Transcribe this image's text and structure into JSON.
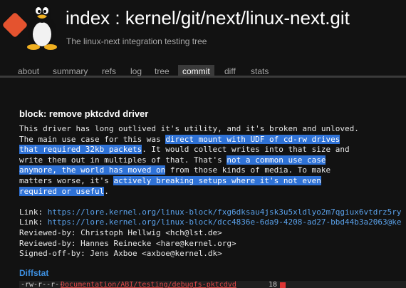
{
  "header": {
    "title": "index : kernel/git/next/linux-next.git",
    "subtitle": "The linux-next integration testing tree"
  },
  "tabs": [
    {
      "label": "about"
    },
    {
      "label": "summary"
    },
    {
      "label": "refs"
    },
    {
      "label": "log"
    },
    {
      "label": "tree"
    },
    {
      "label": "commit",
      "active": true
    },
    {
      "label": "diff"
    },
    {
      "label": "stats"
    }
  ],
  "commit": {
    "title": "block: remove pktcdvd driver",
    "message_segments": [
      {
        "text": "This driver has long outlived it's utility, and it's broken and unloved.\nThe main use case for this was "
      },
      {
        "text": "direct mount with UDF of cd-rw drives\nthat required 32kb packets",
        "selected": true
      },
      {
        "text": ". It would collect writes into that size and\nwrite them out in multiples of that. That's "
      },
      {
        "text": "not a common use case\nanymore, the world has moved on",
        "selected": true
      },
      {
        "text": " from those kinds of media. To make\nmatters worse, it's "
      },
      {
        "text": "actively breaking setups where it's not even\nrequired or useful",
        "selected": true
      },
      {
        "text": ".\n\nLink: "
      },
      {
        "text": "https://lore.kernel.org/linux-block/fxg6dksau4jsk3u5xldlyo2m7qgiux6vtdrz5ry",
        "link": true
      },
      {
        "text": "\nLink: "
      },
      {
        "text": "https://lore.kernel.org/linux-block/dcc4836e-6da9-4208-ad27-bbd44b3a2063@ke",
        "link": true
      },
      {
        "text": "\nReviewed-by: Christoph Hellwig <hch@lst.de>\nReviewed-by: Hannes Reinecke <hare@kernel.org>\nSigned-off-by: Jens Axboe <axboe@kernel.dk>"
      }
    ]
  },
  "diffstat": {
    "label": "Diffstat",
    "rows": [
      {
        "mode": "-rw-r--r--",
        "file": "Documentation/ABI/testing/debugfs-pktcdvd",
        "count": "18"
      }
    ]
  },
  "colors": {
    "background": "#121212",
    "selection": "#2f72d6",
    "link": "#5aa0e8",
    "logo": "#e4532f"
  }
}
